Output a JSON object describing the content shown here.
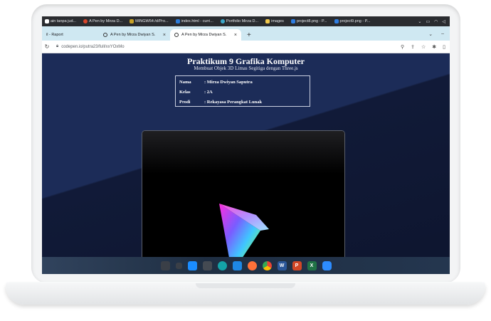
{
  "bookmarks": [
    {
      "label": "ain tanpa jud...",
      "color": "#ffffff"
    },
    {
      "label": "A Pen by Mirza D...",
      "color": "#d9452b"
    },
    {
      "label": "MINGW64:/d/Pro...",
      "color": "#c9a227"
    },
    {
      "label": "index.html - curri...",
      "color": "#2b7bd9"
    },
    {
      "label": "Portfolio Mirza D...",
      "color": "#3ba7c9"
    },
    {
      "label": "images",
      "color": "#f2c94c"
    },
    {
      "label": "project8.png - P...",
      "color": "#2f7de1"
    },
    {
      "label": "project9.png - P...",
      "color": "#2f7de1"
    }
  ],
  "tabs": [
    {
      "label": "il - Raport"
    },
    {
      "label": "A Pen by Mirza Dwiyan S.",
      "close": "×"
    },
    {
      "label": "A Pen by Mirza Dwiyan S.",
      "close": "×"
    }
  ],
  "new_tab": "+",
  "address": {
    "url": "codepen.io/putra23/full/xxYOxMo"
  },
  "page": {
    "title": "Praktikum 9 Grafika Komputer",
    "subtitle": "Membuat Objek 3D Limas Segitiga dengan Three.js",
    "info": [
      {
        "key": "Nama",
        "value": ": Mirza Dwiyan Saputra"
      },
      {
        "key": "Kelas",
        "value": ": 2A"
      },
      {
        "key": "Prodi",
        "value": ": Rekayasa Perangkat Lunak"
      }
    ]
  },
  "taskbar_icons": [
    {
      "name": "file-explorer-icon",
      "color": "#3a3f47"
    },
    {
      "name": "task-view-icon",
      "color": "#3a3f47"
    },
    {
      "name": "windows-start-icon",
      "color": "#1a8cff"
    },
    {
      "name": "terminal-icon",
      "color": "#444a52"
    },
    {
      "name": "arduino-icon",
      "color": "#14a3a8"
    },
    {
      "name": "vscode-icon",
      "color": "#1e88e5"
    },
    {
      "name": "firefox-icon",
      "color": "#ff7139"
    },
    {
      "name": "chrome-icon",
      "color": "#f4b400"
    },
    {
      "name": "word-icon",
      "color": "#2b579a"
    },
    {
      "name": "powerpoint-icon",
      "color": "#d24726"
    },
    {
      "name": "excel-icon",
      "color": "#217346"
    },
    {
      "name": "zoom-icon",
      "color": "#2d8cff"
    }
  ]
}
